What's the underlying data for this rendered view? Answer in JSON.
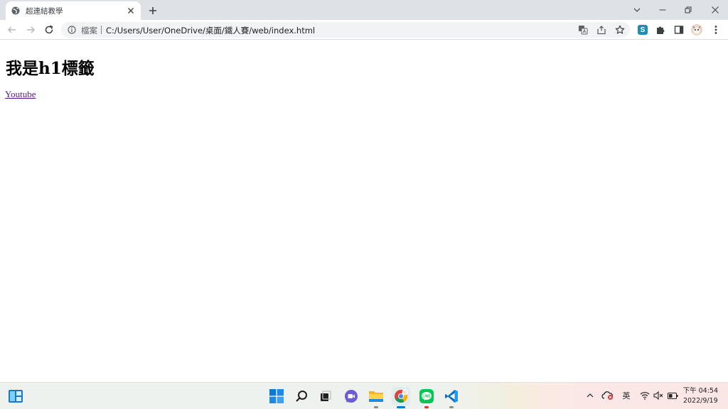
{
  "browser": {
    "tab": {
      "title": "超連結教學",
      "favicon": "globe-icon"
    },
    "address": {
      "security_label": "檔案",
      "url": "C:/Users/User/OneDrive/桌面/鐵人賽/web/index.html"
    },
    "extension_badge": "S"
  },
  "page": {
    "heading": "我是h1標籤",
    "link_text": "Youtube"
  },
  "taskbar": {
    "input_language": "英",
    "time": "下午 04:54",
    "date": "2022/9/19"
  },
  "colors": {
    "tab_strip": "#dee1e6",
    "omnibox": "#f1f3f4",
    "visited_link": "#551a8b",
    "windows_blue": "#0078d4",
    "line_green": "#06c755",
    "vscode_blue": "#0a6fc2"
  }
}
